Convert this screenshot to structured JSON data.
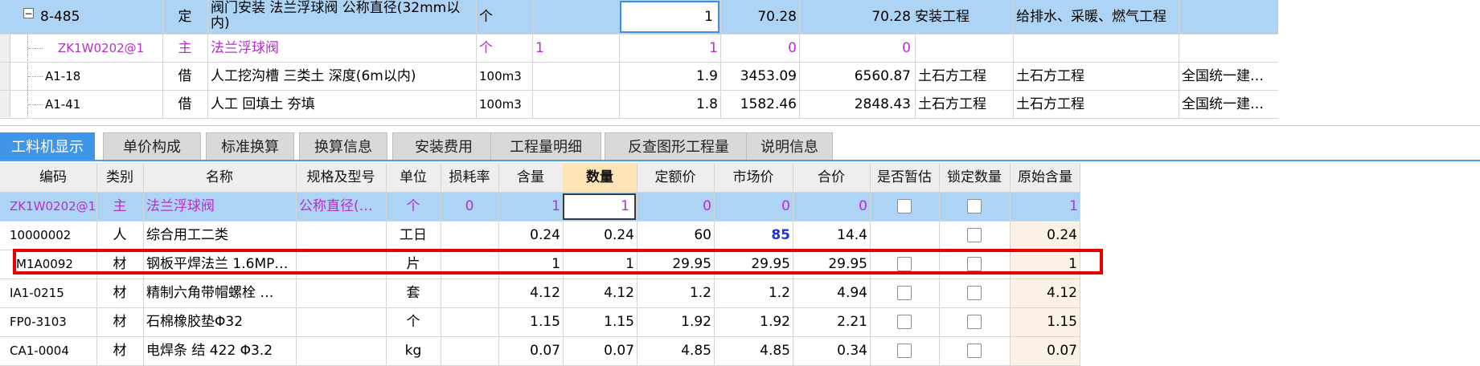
{
  "top_rows": [
    {
      "code": "8-485",
      "type": "定",
      "name": "阀门安装 法兰浮球阀 公称直径(32mm以内)",
      "unit": "个",
      "col5": "",
      "qty": "1",
      "price": "70.28",
      "total": "70.28",
      "cat1": "安装工程",
      "cat2": "给排水、采暖、燃气工程",
      "cat3": "",
      "expander": "−"
    },
    {
      "code": "ZK1W0202@1",
      "type": "主",
      "name": "法兰浮球阀",
      "unit": "个",
      "col5": "1",
      "qty": "1",
      "price": "0",
      "total": "0",
      "cat1": "",
      "cat2": "",
      "cat3": ""
    },
    {
      "code": "A1-18",
      "type": "借",
      "name": "人工挖沟槽 三类土 深度(6m以内)",
      "unit": "100m3",
      "col5": "",
      "qty": "1.9",
      "price": "3453.09",
      "total": "6560.87",
      "cat1": "土石方工程",
      "cat2": "土石方工程",
      "cat3": "全国统一建…"
    },
    {
      "code": "A1-41",
      "type": "借",
      "name": "人工 回填土 夯填",
      "unit": "100m3",
      "col5": "",
      "qty": "1.8",
      "price": "1582.46",
      "total": "2848.43",
      "cat1": "土石方工程",
      "cat2": "土石方工程",
      "cat3": "全国统一建…"
    }
  ],
  "tabs": [
    "工料机显示",
    "单价构成",
    "标准换算",
    "换算信息",
    "安装费用",
    "工程量明细",
    "反查图形工程量",
    "说明信息"
  ],
  "headers": {
    "code": "编码",
    "type": "类别",
    "name": "名称",
    "spec": "规格及型号",
    "unit": "单位",
    "loss": "损耗率",
    "content": "含量",
    "qty": "数量",
    "quota_price": "定额价",
    "market_price": "市场价",
    "total": "合价",
    "provisional": "是否暂估",
    "lock_qty": "锁定数量",
    "orig_content": "原始含量"
  },
  "rows": [
    {
      "code": "ZK1W0202@1",
      "type": "主",
      "name": "法兰浮球阀",
      "spec": "公称直径(…",
      "unit": "个",
      "loss": "0",
      "content": "1",
      "qty": "1",
      "quota_price": "0",
      "market_price": "0",
      "total": "0",
      "orig": "1"
    },
    {
      "code": "10000002",
      "type": "人",
      "name": "综合用工二类",
      "spec": "",
      "unit": "工日",
      "loss": "",
      "content": "0.24",
      "qty": "0.24",
      "quota_price": "60",
      "market_price": "85",
      "total": "14.4",
      "orig": "0.24"
    },
    {
      "code": "M1A0092",
      "type": "材",
      "name": "钢板平焊法兰 1.6MP…",
      "spec": "",
      "unit": "片",
      "loss": "",
      "content": "1",
      "qty": "1",
      "quota_price": "29.95",
      "market_price": "29.95",
      "total": "29.95",
      "orig": "1"
    },
    {
      "code": "IA1-0215",
      "type": "材",
      "name": "精制六角带帽螺栓 …",
      "spec": "",
      "unit": "套",
      "loss": "",
      "content": "4.12",
      "qty": "4.12",
      "quota_price": "1.2",
      "market_price": "1.2",
      "total": "4.94",
      "orig": "4.12"
    },
    {
      "code": "FP0-3103",
      "type": "材",
      "name": "石棉橡胶垫Φ32",
      "spec": "",
      "unit": "个",
      "loss": "",
      "content": "1.15",
      "qty": "1.15",
      "quota_price": "1.92",
      "market_price": "1.92",
      "total": "2.21",
      "orig": "1.15"
    },
    {
      "code": "CA1-0004",
      "type": "材",
      "name": "电焊条 结 422 Φ3.2",
      "spec": "",
      "unit": "kg",
      "loss": "",
      "content": "0.07",
      "qty": "0.07",
      "quota_price": "4.85",
      "market_price": "4.85",
      "total": "0.34",
      "orig": "0.07"
    }
  ],
  "colors": {
    "selected_row": "#aed4f5",
    "active_tab": "#3f96e8",
    "qty_header": "#fde4b4",
    "highlight": "#e60000",
    "main_material_text": "#b430c8"
  }
}
